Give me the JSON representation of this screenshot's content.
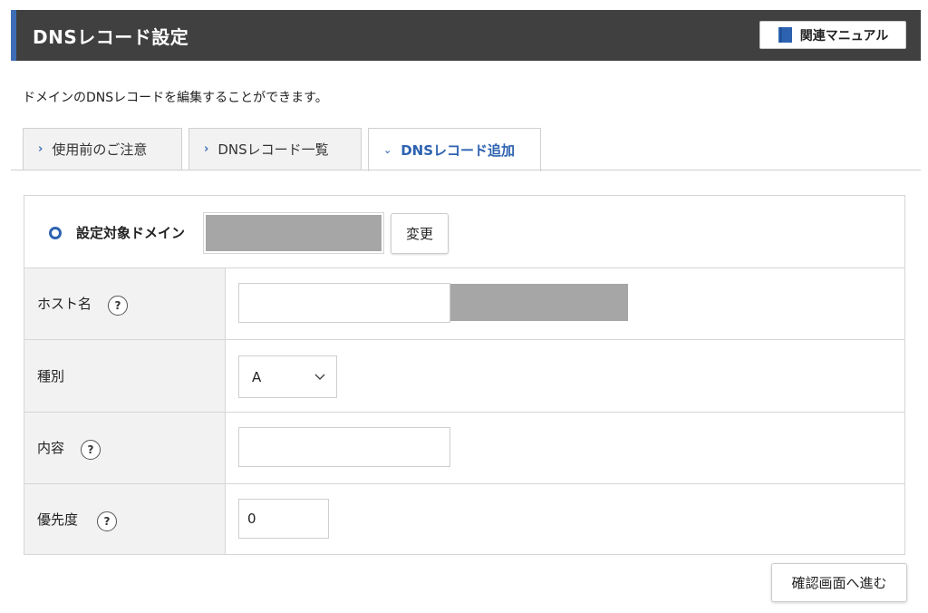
{
  "header": {
    "title": "DNSレコード設定",
    "manual_button": "関連マニュアル",
    "accent_color": "#3d6db5"
  },
  "description": "ドメインのDNSレコードを編集することができます。",
  "tabs": [
    {
      "label": "使用前のご注意",
      "icon": "chevron-right-icon",
      "active": false
    },
    {
      "label": "DNSレコード一覧",
      "icon": "chevron-right-icon",
      "active": false
    },
    {
      "label": "DNSレコード追加",
      "icon": "chevron-down-icon",
      "active": true
    }
  ],
  "form": {
    "domain": {
      "label": "設定対象ドメイン",
      "change_button": "変更"
    },
    "host": {
      "label": "ホスト名",
      "value": ""
    },
    "type": {
      "label": "種別",
      "value": "A"
    },
    "content": {
      "label": "内容",
      "value": ""
    },
    "priority": {
      "label": "優先度",
      "value": "0"
    },
    "help_glyph": "?"
  },
  "confirm_button": "確認画面へ進む"
}
